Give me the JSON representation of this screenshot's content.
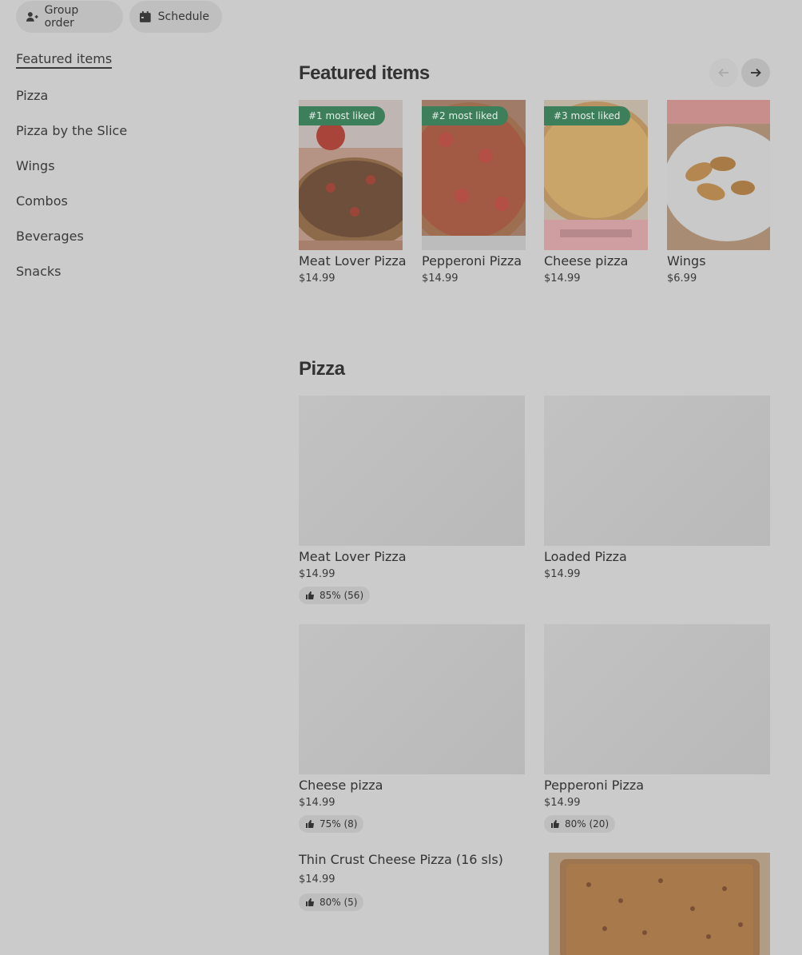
{
  "top_actions": {
    "group_order": "Group order",
    "schedule": "Schedule"
  },
  "sidebar": {
    "items": [
      {
        "label": "Featured items"
      },
      {
        "label": "Pizza"
      },
      {
        "label": "Pizza by the Slice"
      },
      {
        "label": "Wings"
      },
      {
        "label": "Combos"
      },
      {
        "label": "Beverages"
      },
      {
        "label": "Snacks"
      }
    ]
  },
  "featured": {
    "title": "Featured items",
    "items": [
      {
        "badge": "#1 most liked",
        "name": "Meat Lover Pizza",
        "price": "$14.99"
      },
      {
        "badge": "#2 most liked",
        "name": "Pepperoni Pizza",
        "price": "$14.99"
      },
      {
        "badge": "#3 most liked",
        "name": "Cheese pizza",
        "price": "$14.99"
      },
      {
        "badge": "",
        "name": "Wings",
        "price": "$6.99"
      }
    ]
  },
  "pizza": {
    "title": "Pizza",
    "items": [
      {
        "name": "Meat Lover Pizza",
        "price": "$14.99",
        "rating": "85% (56)"
      },
      {
        "name": "Loaded Pizza",
        "price": "$14.99",
        "rating": ""
      },
      {
        "name": "Cheese pizza",
        "price": "$14.99",
        "rating": "75% (8)"
      },
      {
        "name": "Pepperoni Pizza",
        "price": "$14.99",
        "rating": "80% (20)"
      },
      {
        "name": "Thin Crust Cheese Pizza (16 sls)",
        "price": "$14.99",
        "rating": "80% (5)"
      }
    ]
  },
  "colors": {
    "overlay_bg": "#cbcbcb",
    "badge_green": "#3d7f5b",
    "chip_bg": "#bfbfbf"
  }
}
